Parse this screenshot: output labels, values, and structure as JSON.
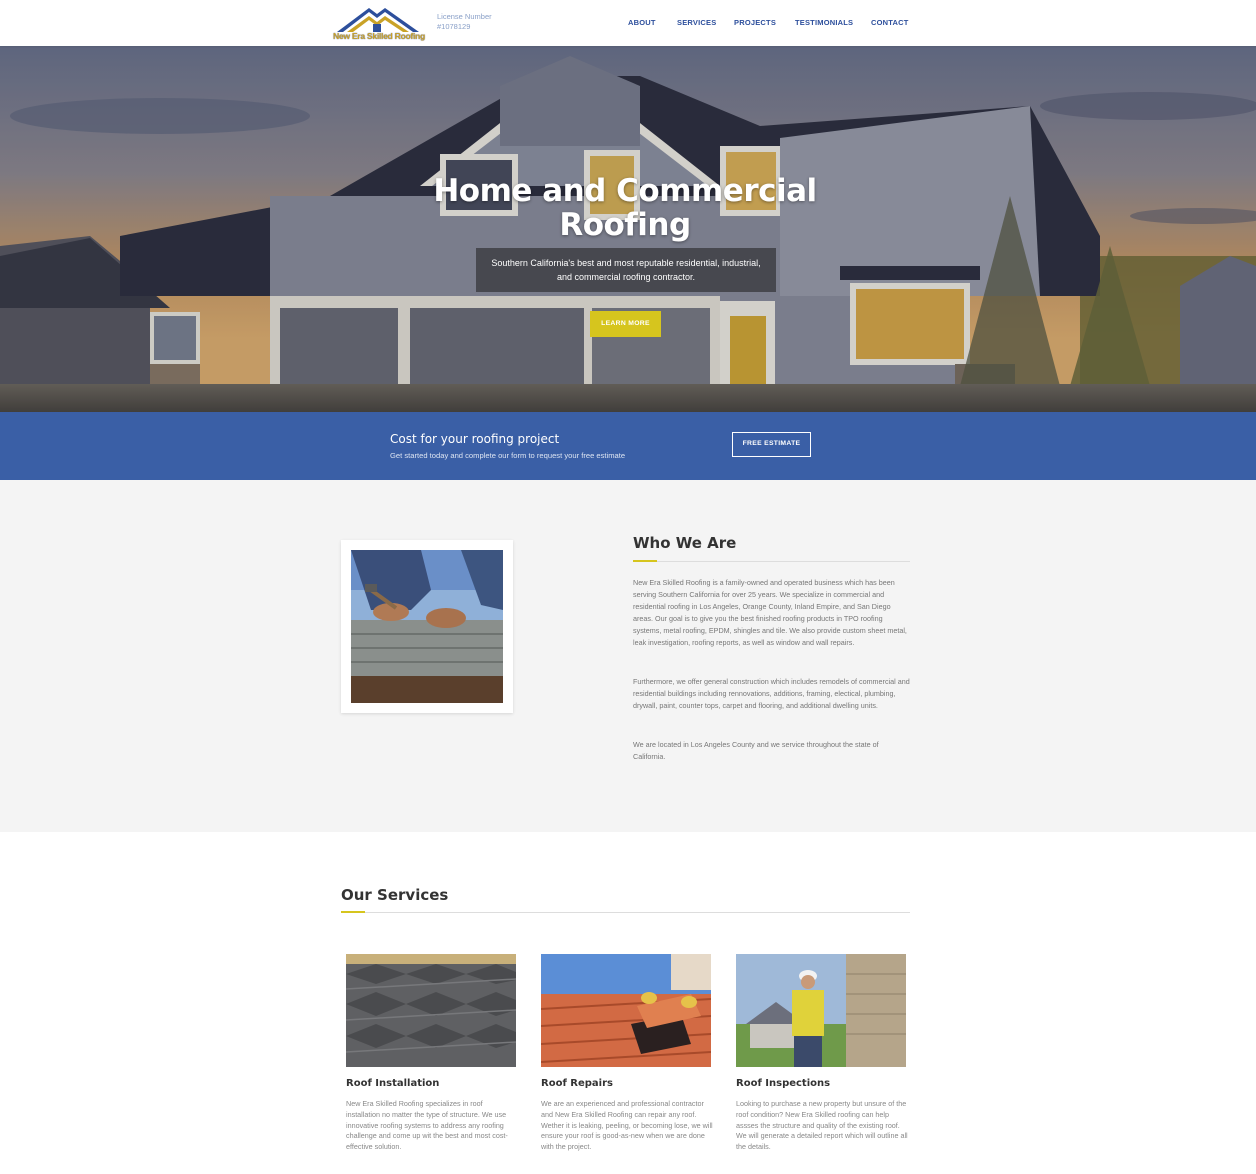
{
  "header": {
    "logo_text": "New Era Skilled Roofing",
    "license_label": "License Number",
    "license_number": "#1078129",
    "nav": [
      "ABOUT",
      "SERVICES",
      "PROJECTS",
      "TESTIMONIALS",
      "CONTACT"
    ]
  },
  "hero": {
    "title_line1": "Home and Commercial",
    "title_line2": "Roofing",
    "subtitle_line1": "Southern California's best and most reputable residential, industrial,",
    "subtitle_line2": "and commercial roofing contractor.",
    "button": "LEARN MORE"
  },
  "estimate": {
    "title": "Cost for your roofing project",
    "subtitle": "Get started today and complete our form to request your free estimate",
    "button": "FREE ESTIMATE"
  },
  "about": {
    "title": "Who We Are",
    "paragraphs": [
      "New Era Skilled Roofing is a family-owned and operated business which has been serving Southern California for over 25 years. We specialize in commercial and residential roofing in Los Angeles, Orange County, Inland Empire, and San Diego areas. Our goal is to give you the best finished roofing products in TPO roofing systems, metal roofing, EPDM, shingles and tile. We also provide custom sheet metal, leak investigation, roofing reports, as well as window and wall repairs.",
      "Furthermore, we offer general construction which includes remodels of commercial and residential buildings including rennovations, additions, framing, electical, plumbing, drywall, paint, counter tops, carpet and flooring, and additional dwelling units.",
      "We are located in Los Angeles County and we service throughout the state of California."
    ]
  },
  "services": {
    "title": "Our Services",
    "cards": [
      {
        "title": "Roof Installation",
        "text": "New Era Skilled Roofing specializes in roof installation no matter the type of structure. We use innovative roofing systems to address any roofing challenge and come up wit the best and most cost-effective solution."
      },
      {
        "title": "Roof Repairs",
        "text": "We are an experienced and professional contractor and New Era Skilled Roofing can repair any roof. Wether it is leaking, peeling, or becoming lose, we will ensure your roof is good-as-new when we are done with the project."
      },
      {
        "title": "Roof Inspections",
        "text": "Looking to purchase a new property but unsure of the roof condition? New Era Skilled roofing can help assses the structure and quality of the existing roof. We will generate a detailed report which will outline all the details."
      }
    ]
  },
  "colors": {
    "brand_blue": "#3a5fa6",
    "accent_yellow": "#d6c51e",
    "nav_blue": "#2d4f9c"
  }
}
